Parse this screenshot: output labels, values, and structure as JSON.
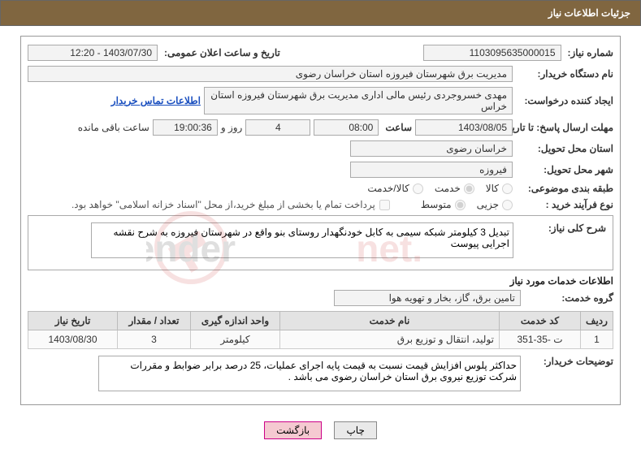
{
  "header": {
    "title": "جزئیات اطلاعات نیاز"
  },
  "fields": {
    "need_no_label": "شماره نیاز:",
    "need_no": "1103095635000015",
    "announce_label": "تاریخ و ساعت اعلان عمومی:",
    "announce_value": "1403/07/30 - 12:20",
    "buyer_org_label": "نام دستگاه خریدار:",
    "buyer_org": "مدیریت برق شهرستان فیروزه استان خراسان رضوی",
    "requester_label": "ایجاد کننده درخواست:",
    "requester": "مهدی خسروجردی رئیس مالی اداری مدیریت برق شهرستان فیروزه استان خراس",
    "contact_link": "اطلاعات تماس خریدار",
    "response_deadline_label": "مهلت ارسال پاسخ: تا تاریخ:",
    "resp_date": "1403/08/05",
    "hour_label": "ساعت",
    "resp_hour": "08:00",
    "days": "4",
    "days_label": "روز و",
    "remain_time": "19:00:36",
    "remain_label": "ساعت باقی مانده",
    "province_label": "استان محل تحویل:",
    "province": "خراسان رضوی",
    "city_label": "شهر محل تحویل:",
    "city": "فیروزه",
    "subject_class_label": "طبقه بندی موضوعی:",
    "opt_kala": "کالا",
    "opt_service": "خدمت",
    "opt_kala_service": "کالا/خدمت",
    "purchase_type_label": "نوع فرآیند خرید :",
    "opt_jozi": "جزیی",
    "opt_mid": "متوسط",
    "partial_pay": "پرداخت تمام یا بخشی از مبلغ خرید،از محل \"اسناد خزانه اسلامی\" خواهد بود.",
    "overall_label": "شرح کلی نیاز:",
    "overall_text": "تبدیل 3 کیلومتر شبکه سیمی به کابل خودنگهدار روستای بنو واقع در شهرستان فیروزه به شرح نقشه اجرایی پیوست",
    "svc_info_title": "اطلاعات خدمات مورد نیاز",
    "group_label": "گروه خدمت:",
    "group_value": "تامین برق، گاز، بخار و تهویه هوا",
    "buyer_notes_label": "توضیحات خریدار:",
    "buyer_notes": "حداکثر پلوس افزایش قیمت نسبت به قیمت پایه اجرای عملیات، 25 درصد برابر ضوابط و مقررات شرکت توزیع نیروی برق استان خراسان رضوی می باشد ."
  },
  "table": {
    "headers": [
      "ردیف",
      "کد خدمت",
      "نام خدمت",
      "واحد اندازه گیری",
      "تعداد / مقدار",
      "تاریخ نیاز"
    ],
    "rows": [
      {
        "row": "1",
        "code": "ت -35-351",
        "name": "تولید، انتقال و توزیع برق",
        "unit": "کیلومتر",
        "qty": "3",
        "date": "1403/08/30"
      }
    ]
  },
  "buttons": {
    "print": "چاپ",
    "back": "بازگشت"
  }
}
